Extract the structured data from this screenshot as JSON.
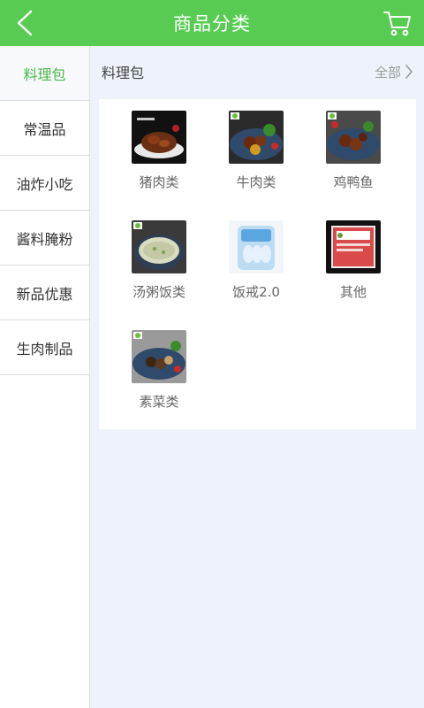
{
  "header": {
    "title": "商品分类",
    "back_icon": "chevron-left-icon",
    "cart_icon": "cart-icon"
  },
  "sidebar": {
    "items": [
      {
        "label": "料理包",
        "active": true
      },
      {
        "label": "常温品"
      },
      {
        "label": "油炸小吃"
      },
      {
        "label": "酱料腌粉"
      },
      {
        "label": "新品优惠"
      },
      {
        "label": "生肉制品"
      }
    ]
  },
  "main": {
    "section_title": "料理包",
    "all_label": "全部",
    "categories": [
      {
        "label": "猪肉类"
      },
      {
        "label": "牛肉类"
      },
      {
        "label": "鸡鸭鱼"
      },
      {
        "label": "汤粥饭类"
      },
      {
        "label": "饭戒2.0"
      },
      {
        "label": "其他"
      },
      {
        "label": "素菜类"
      }
    ]
  },
  "colors": {
    "brand_green": "#58cc52",
    "active_text": "#4cb848"
  }
}
